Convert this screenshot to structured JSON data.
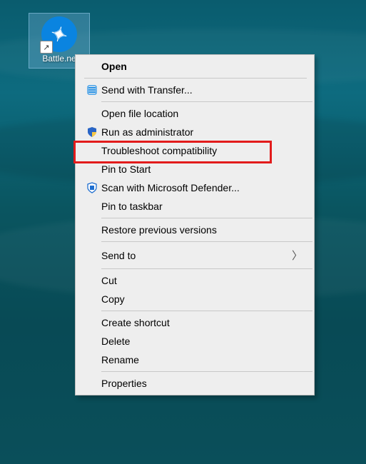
{
  "desktop": {
    "icon_label": "Battle.ne",
    "shortcut_arrow": "↗"
  },
  "menu": {
    "open": "Open",
    "send_transfer": "Send with Transfer...",
    "open_location": "Open file location",
    "run_admin": "Run as administrator",
    "troubleshoot": "Troubleshoot compatibility",
    "pin_start": "Pin to Start",
    "scan_defender": "Scan with Microsoft Defender...",
    "pin_taskbar": "Pin to taskbar",
    "restore": "Restore previous versions",
    "send_to": "Send to",
    "cut": "Cut",
    "copy": "Copy",
    "create_shortcut": "Create shortcut",
    "delete": "Delete",
    "rename": "Rename",
    "properties": "Properties"
  }
}
